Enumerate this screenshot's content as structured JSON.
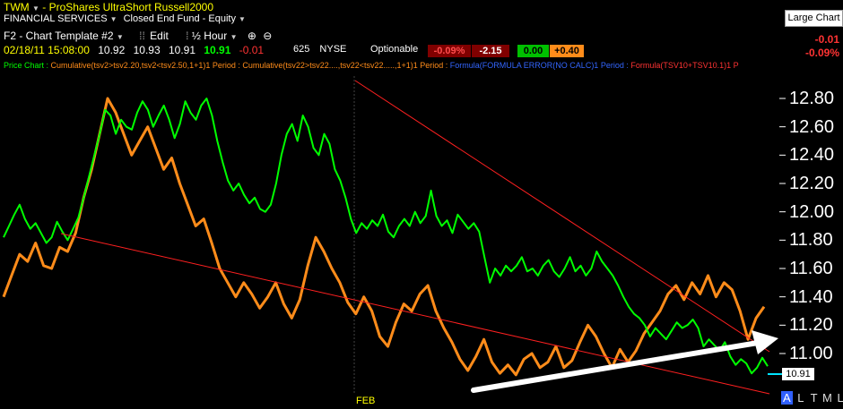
{
  "header": {
    "symbol": "TWM",
    "separator": "-",
    "name": "ProShares UltraShort Russell2000",
    "sector": "FINANCIAL SERVICES",
    "fund_type": "Closed End Fund - Equity",
    "large_chart_label": "Large Chart"
  },
  "toolbar": {
    "template": "F2 - Chart Template #2",
    "edit": "Edit",
    "interval": "½ Hour",
    "shares": "625",
    "exchange": "NYSE",
    "optionable": "Optionable"
  },
  "quote": {
    "datetime": "02/18/11 15:08:00",
    "open": "10.92",
    "high": "10.93",
    "low": "10.91",
    "last": "10.91",
    "change": "-0.01",
    "pct_change": "-0.09%",
    "box1": "-0.09%",
    "box2": "-2.15",
    "box3": "0.00",
    "box4": "+0.40",
    "right_change": "-0.01",
    "right_pct": "-0.09%"
  },
  "legend": {
    "price_chart": "Price Chart :",
    "item1": "Cumulative(tsv2>tsv2.20,tsv2<tsv2.50,1+1)1 Period :",
    "item2": "Cumulative(tsv22>tsv22....,tsv22<tsv22.....,1+1)1 Period :",
    "item3": "Formula(FORMULA ERROR(NO CALC)1 Period :",
    "item4": "Formula(TSV10+TSV10.1)1 P"
  },
  "axis": {
    "tick_labels": [
      "12.80",
      "12.60",
      "12.40",
      "12.20",
      "12.00",
      "11.80",
      "11.60",
      "11.40",
      "11.20",
      "11.00"
    ],
    "feb_label": "FEB",
    "current_price_label": "10.91"
  },
  "bottom_buttons": [
    "A",
    "L",
    "T",
    "M",
    "L"
  ],
  "colors": {
    "price": "#00ff00",
    "indicator": "#ff8c1a",
    "trendline": "#ff2020",
    "arrow": "#ffffff",
    "text_yellow": "#ffff00",
    "neg": "#ff3333"
  },
  "chart_data": {
    "type": "line",
    "title": "TWM - ProShares UltraShort Russell2000",
    "x_label_shown": "FEB",
    "ylim": [
      10.9,
      12.9
    ],
    "yticks": [
      12.8,
      12.6,
      12.4,
      12.2,
      12.0,
      11.8,
      11.6,
      11.4,
      11.2,
      11.0
    ],
    "last_price": 10.91,
    "series": [
      {
        "name": "",
        "axis": "price",
        "values": [
          11.82,
          11.9,
          11.98,
          12.05,
          11.95,
          11.88,
          11.92,
          11.85,
          11.78,
          11.82,
          11.93,
          11.86,
          11.8,
          11.88,
          11.96,
          12.1,
          12.25,
          12.4,
          12.55,
          12.72,
          12.68,
          12.55,
          12.65,
          12.6,
          12.58,
          12.7,
          12.78,
          12.72,
          12.6,
          12.68,
          12.75,
          12.65,
          12.52,
          12.62,
          12.78,
          12.7,
          12.65,
          12.75,
          12.8,
          12.68,
          12.5,
          12.35,
          12.22,
          12.15,
          12.2,
          12.12,
          12.06,
          12.1,
          12.02,
          12.0,
          12.05,
          12.2,
          12.4,
          12.55,
          12.62,
          12.5,
          12.68,
          12.6,
          12.45,
          12.4,
          12.55,
          12.48,
          12.3,
          12.22,
          12.1,
          11.95,
          11.85,
          11.92,
          11.88,
          11.94,
          11.9,
          11.98,
          11.86,
          11.82,
          11.9,
          11.95,
          11.9,
          12.0,
          11.92,
          11.97,
          12.15,
          11.97,
          11.9,
          11.94,
          11.85,
          11.98,
          11.93,
          11.88,
          11.92,
          11.86,
          11.68,
          11.5,
          11.6,
          11.55,
          11.62,
          11.58,
          11.62,
          11.68,
          11.58,
          11.6,
          11.55,
          11.62,
          11.66,
          11.58,
          11.54,
          11.6,
          11.68,
          11.58,
          11.62,
          11.55,
          11.6,
          11.72,
          11.65,
          11.6,
          11.55,
          11.48,
          11.4,
          11.33,
          11.28,
          11.25,
          11.2,
          11.12,
          11.18,
          11.14,
          11.1,
          11.16,
          11.22,
          11.18,
          11.2,
          11.24,
          11.18,
          11.05,
          11.1,
          11.06,
          11.02,
          11.08,
          10.98,
          10.92,
          10.96,
          10.93,
          10.86,
          10.9,
          10.97,
          10.91
        ]
      },
      {
        "name": "",
        "axis": "indicator",
        "values": [
          11.4,
          11.55,
          11.7,
          11.65,
          11.78,
          11.62,
          11.6,
          11.75,
          11.72,
          11.85,
          12.1,
          12.3,
          12.55,
          12.8,
          12.7,
          12.55,
          12.4,
          12.5,
          12.6,
          12.45,
          12.3,
          12.38,
          12.2,
          12.05,
          11.9,
          11.95,
          11.78,
          11.6,
          11.5,
          11.4,
          11.5,
          11.42,
          11.32,
          11.4,
          11.5,
          11.35,
          11.25,
          11.38,
          11.62,
          11.82,
          11.72,
          11.6,
          11.5,
          11.36,
          11.28,
          11.4,
          11.3,
          11.12,
          11.05,
          11.22,
          11.35,
          11.3,
          11.42,
          11.48,
          11.3,
          11.18,
          11.08,
          10.96,
          10.88,
          10.98,
          11.1,
          10.94,
          10.86,
          10.92,
          10.85,
          10.96,
          11.0,
          10.9,
          10.94,
          11.05,
          10.9,
          10.95,
          11.08,
          11.2,
          11.12,
          11.0,
          10.9,
          11.03,
          10.94,
          11.02,
          11.14,
          11.22,
          11.3,
          11.42,
          11.48,
          11.38,
          11.5,
          11.42,
          11.55,
          11.4,
          11.5,
          11.45,
          11.3,
          11.1,
          11.25,
          11.33
        ]
      }
    ],
    "annotations": [
      "red downward trendline from upper-left across chart",
      "red rising support trendline",
      "white upward arrow near lows"
    ]
  }
}
